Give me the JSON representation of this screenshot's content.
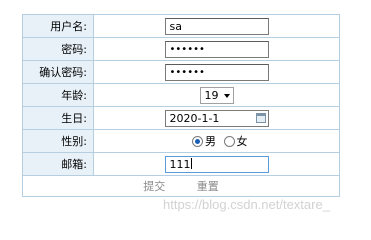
{
  "form": {
    "username": {
      "label": "用户名:",
      "value": "sa"
    },
    "password": {
      "label": "密码:",
      "value": "••••••"
    },
    "confirm_password": {
      "label": "确认密码:",
      "value": "••••••"
    },
    "age": {
      "label": "年龄:",
      "selected": "19"
    },
    "birthday": {
      "label": "生日:",
      "value": "2020-1-1"
    },
    "gender": {
      "label": "性别:",
      "options": [
        "男",
        "女"
      ],
      "selected": "男"
    },
    "email": {
      "label": "邮箱:",
      "value": "111"
    }
  },
  "buttons": {
    "submit": "提交",
    "reset": "重置"
  },
  "watermark": "https://blog.csdn.net/textare_"
}
